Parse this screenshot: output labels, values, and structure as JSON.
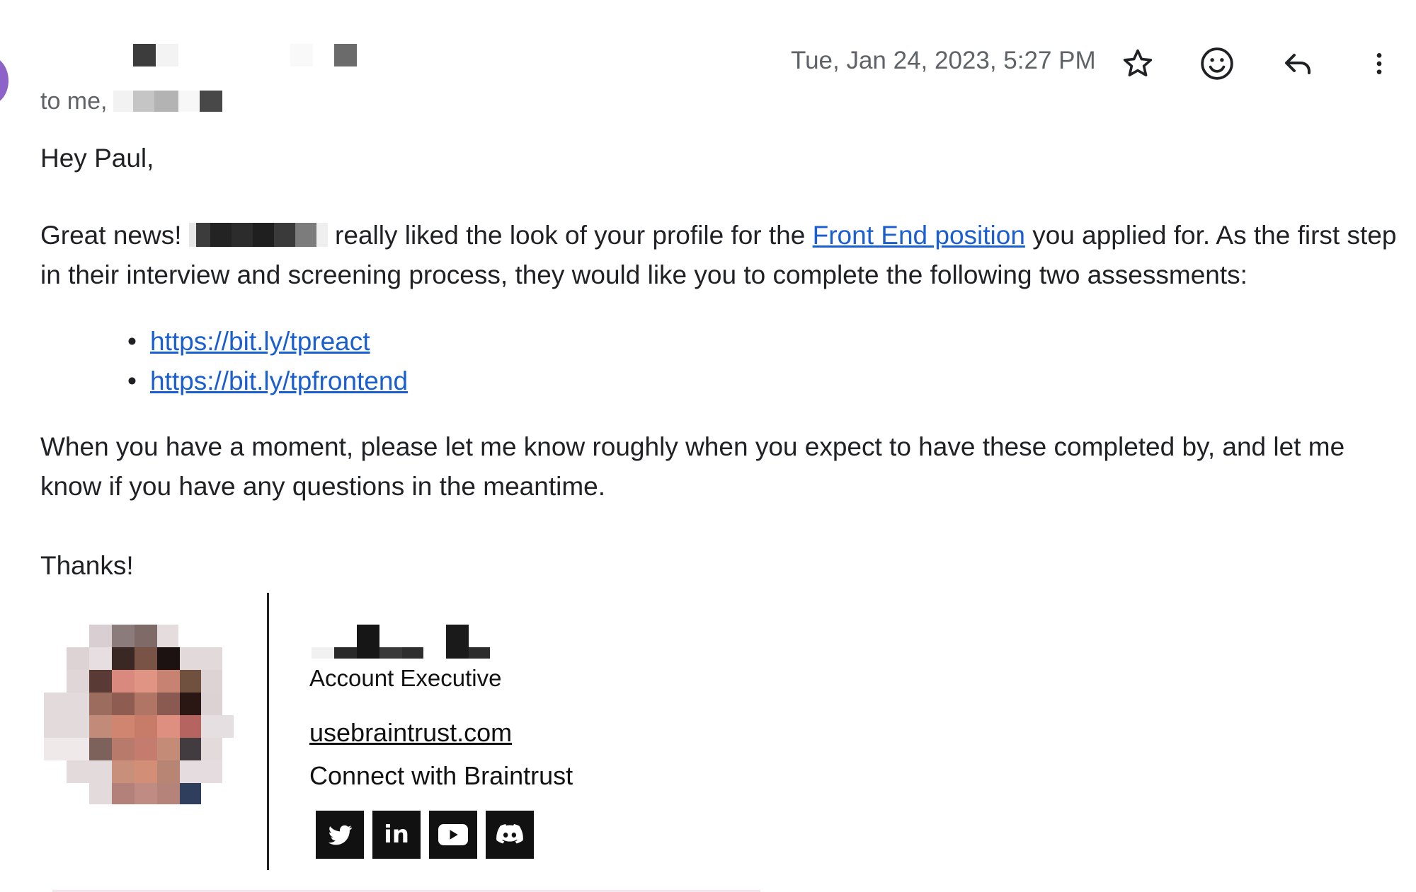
{
  "email": {
    "date": "Tue, Jan 24, 2023, 5:27 PM",
    "to_label": "to me,",
    "greeting": "Hey Paul,",
    "p1_start": "Great news!",
    "p1_mid": "really liked the look of your profile for the",
    "p1_link": "Front End position",
    "p1_end": "you applied for. As the first step in their interview and screening process, they would like you to complete the following two assessments:",
    "links": [
      "https://bit.ly/tpreact",
      "https://bit.ly/tpfrontend"
    ],
    "p2": "When you have a moment, please let me know roughly when you expect to have these completed by, and let me know if you have any questions in the meantime.",
    "closing": "Thanks!"
  },
  "signature": {
    "title": "Account Executive",
    "website": "usebraintrust.com",
    "connect": "Connect with Braintrust",
    "socials": [
      "twitter-icon",
      "linkedin-icon",
      "youtube-icon",
      "discord-icon"
    ]
  },
  "colors": {
    "link": "#1a5fd1",
    "avatar": "#8e63c9",
    "text": "#202124",
    "muted": "#5f6368"
  }
}
